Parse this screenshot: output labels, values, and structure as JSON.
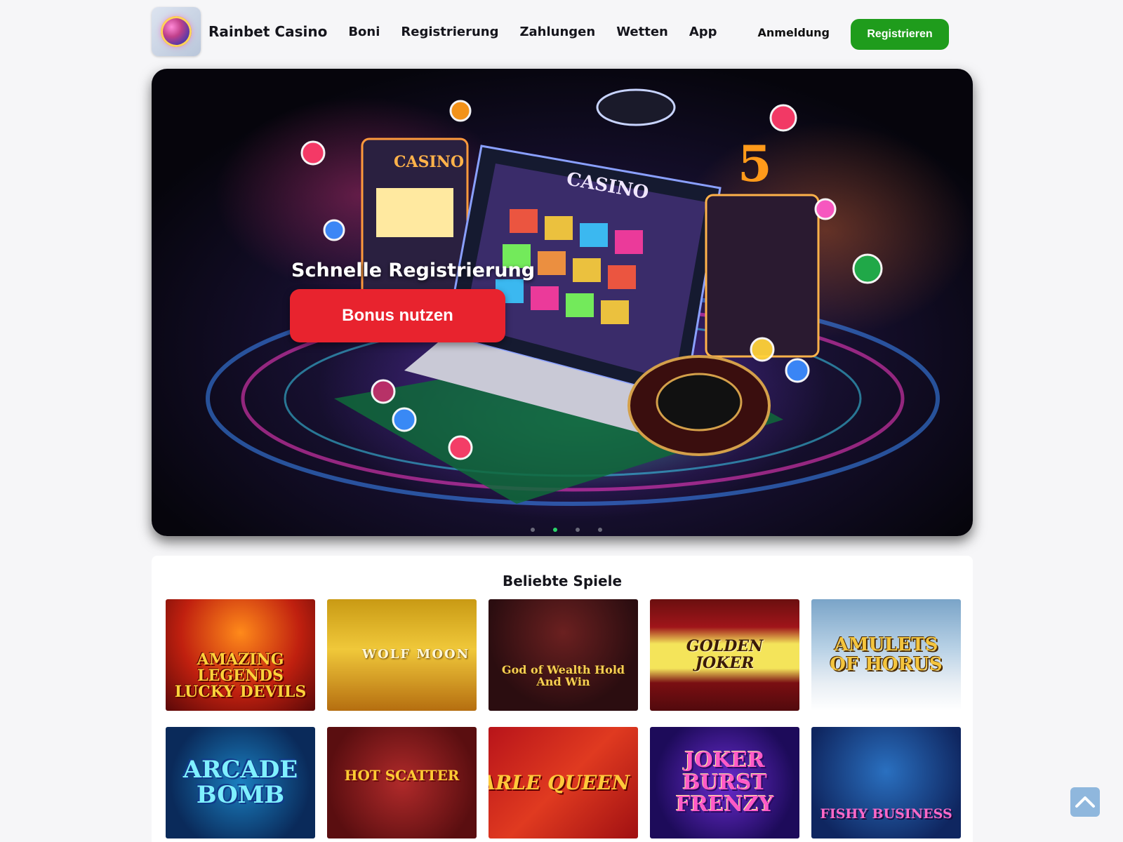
{
  "header": {
    "brand": "Rainbet Casino",
    "nav": [
      "Boni",
      "Registrierung",
      "Zahlungen",
      "Wetten",
      "App"
    ],
    "login_label": "Anmeldung",
    "signup_label": "Registrieren",
    "signup_color": "#1f9c1c"
  },
  "hero": {
    "title": "Schnelle Registrierung",
    "cta_label": "Bonus nutzen",
    "cta_color": "#e8232e",
    "image_texts": [
      "CASINO",
      "CASINO",
      "5"
    ],
    "slides": 4,
    "active_slide": 1
  },
  "games": {
    "title": "Beliebte Spiele",
    "items": [
      {
        "name": "Amazing Legends Lucky Devils"
      },
      {
        "name": "Wolf Moon"
      },
      {
        "name": "God of Wealth Hold And Win"
      },
      {
        "name": "Golden Joker"
      },
      {
        "name": "Amulets of Horus"
      },
      {
        "name": "Arcade Bomb"
      },
      {
        "name": "Hot Scatter"
      },
      {
        "name": "Harle Queen"
      },
      {
        "name": "Joker Burst Frenzy"
      },
      {
        "name": "Fishy Business"
      }
    ]
  },
  "scroll_top": {
    "icon": "chevron-up-icon"
  }
}
